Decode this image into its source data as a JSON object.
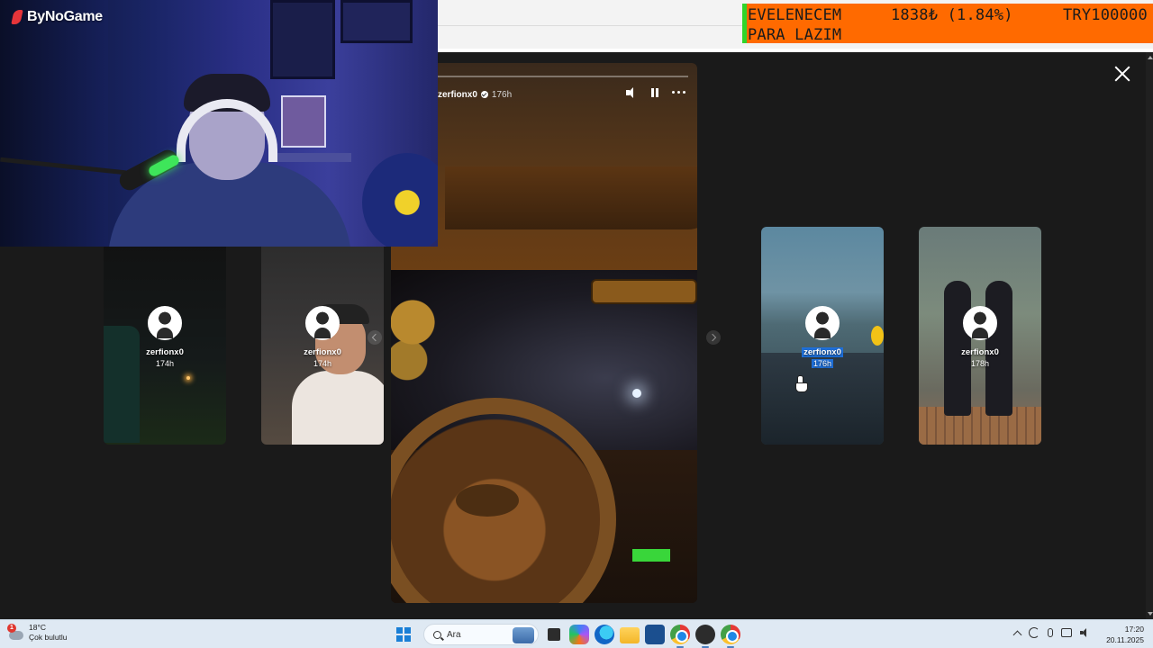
{
  "stream_overlay": {
    "brand": "ByNoGame",
    "ticker": {
      "line1_name": "EVELENECEM",
      "line1_amount": "1838₺ (1.84%)",
      "line1_currency": "TRY100000",
      "line2": "PARA LAZIM",
      "accent": "#ff6a00",
      "bar_color": "#2fd52a"
    }
  },
  "story_viewer": {
    "close_icon": "close-icon",
    "current": {
      "username": "zerfionx0",
      "age": "176h",
      "progress": 0.0,
      "controls": [
        "sound-icon",
        "pause-icon",
        "more-icon"
      ]
    },
    "thumbnails": [
      {
        "username": "zerfionx0",
        "age": "174h",
        "selected": false
      },
      {
        "username": "zerfionx0",
        "age": "174h",
        "selected": false
      },
      {
        "username": "zerfionx0",
        "age": "176h",
        "selected": true
      },
      {
        "username": "zerfionx0",
        "age": "178h",
        "selected": false
      }
    ]
  },
  "taskbar": {
    "weather_temp": "18°C",
    "weather_desc": "Çok bulutlu",
    "weather_badge": "1",
    "search_placeholder": "Ara",
    "apps": [
      "file-explorer-icon",
      "copilot-icon",
      "edge-icon",
      "folder-icon",
      "store-icon",
      "chrome-icon",
      "obs-icon",
      "chrome-profile-icon"
    ],
    "time": "17:20",
    "date": "20.11.2025"
  }
}
